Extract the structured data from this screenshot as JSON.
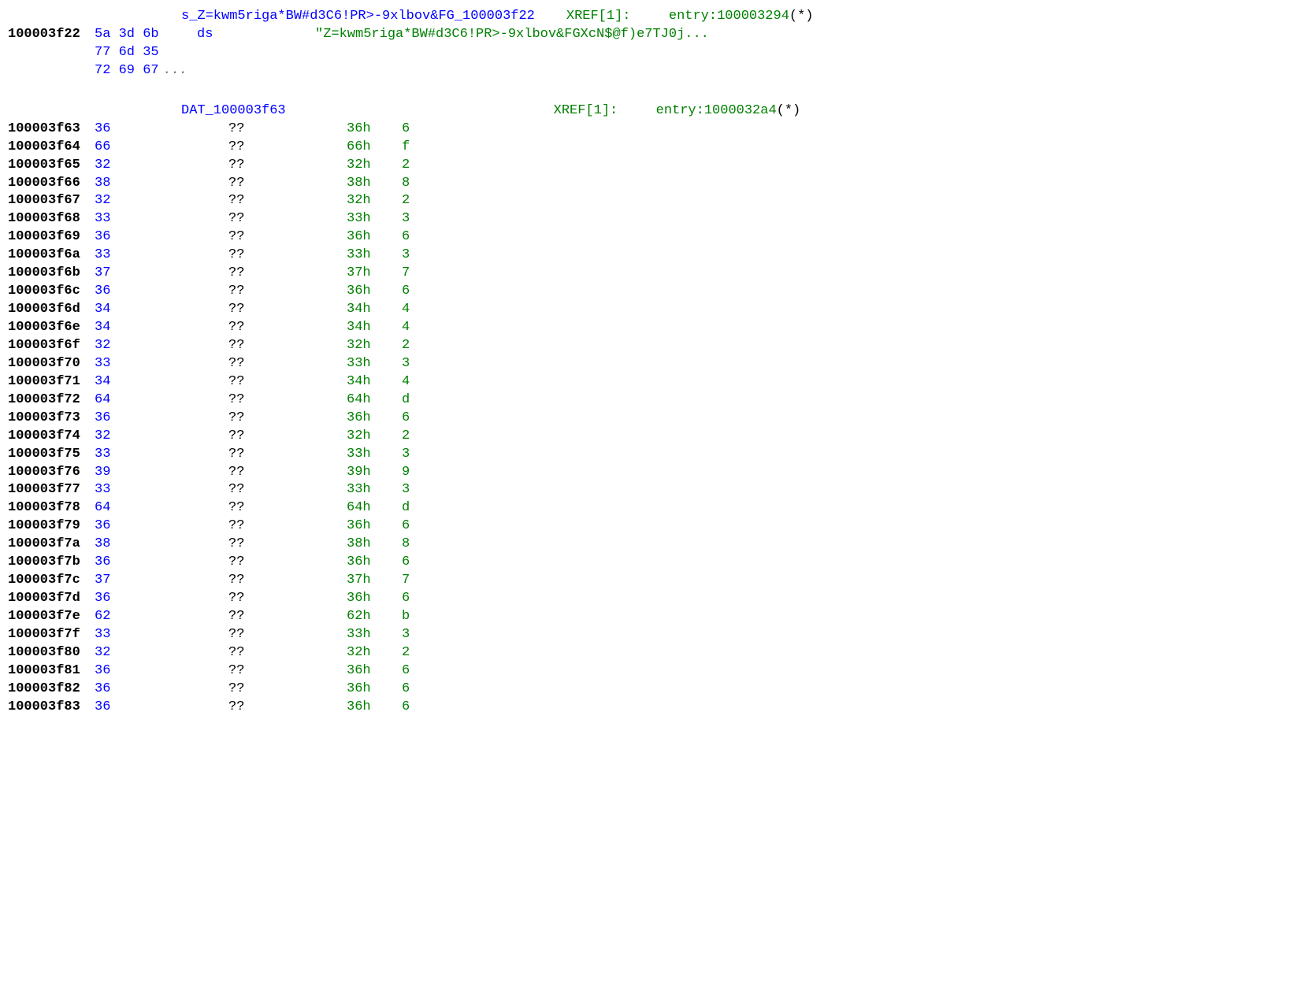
{
  "string_section": {
    "label_name": "s_Z=kwm5riga*BW#d3C6!PR>-9xlbov&FG_100003f22",
    "xref_lbl": "XREF[1]:",
    "xref_val": "entry:100003294",
    "xref_star": "(*)",
    "addr": "100003f22",
    "bytes_rows": [
      "5a 3d 6b",
      "77 6d 35",
      "72 69 67"
    ],
    "ellipsis": "...",
    "mnemonic": "ds",
    "string_value": "\"Z=kwm5riga*BW#d3C6!PR>-9xlbov&FGXcN$@f)e7TJ0j..."
  },
  "data_section": {
    "label_name": "DAT_100003f63",
    "xref_lbl": "XREF[1]:",
    "xref_val": "entry:1000032a4",
    "xref_star": "(*)",
    "qmark": "??",
    "rows": [
      {
        "addr": "100003f63",
        "byte": "36",
        "hex": "36h",
        "ch": "6"
      },
      {
        "addr": "100003f64",
        "byte": "66",
        "hex": "66h",
        "ch": "f"
      },
      {
        "addr": "100003f65",
        "byte": "32",
        "hex": "32h",
        "ch": "2"
      },
      {
        "addr": "100003f66",
        "byte": "38",
        "hex": "38h",
        "ch": "8"
      },
      {
        "addr": "100003f67",
        "byte": "32",
        "hex": "32h",
        "ch": "2"
      },
      {
        "addr": "100003f68",
        "byte": "33",
        "hex": "33h",
        "ch": "3"
      },
      {
        "addr": "100003f69",
        "byte": "36",
        "hex": "36h",
        "ch": "6"
      },
      {
        "addr": "100003f6a",
        "byte": "33",
        "hex": "33h",
        "ch": "3"
      },
      {
        "addr": "100003f6b",
        "byte": "37",
        "hex": "37h",
        "ch": "7"
      },
      {
        "addr": "100003f6c",
        "byte": "36",
        "hex": "36h",
        "ch": "6"
      },
      {
        "addr": "100003f6d",
        "byte": "34",
        "hex": "34h",
        "ch": "4"
      },
      {
        "addr": "100003f6e",
        "byte": "34",
        "hex": "34h",
        "ch": "4"
      },
      {
        "addr": "100003f6f",
        "byte": "32",
        "hex": "32h",
        "ch": "2"
      },
      {
        "addr": "100003f70",
        "byte": "33",
        "hex": "33h",
        "ch": "3"
      },
      {
        "addr": "100003f71",
        "byte": "34",
        "hex": "34h",
        "ch": "4"
      },
      {
        "addr": "100003f72",
        "byte": "64",
        "hex": "64h",
        "ch": "d"
      },
      {
        "addr": "100003f73",
        "byte": "36",
        "hex": "36h",
        "ch": "6"
      },
      {
        "addr": "100003f74",
        "byte": "32",
        "hex": "32h",
        "ch": "2"
      },
      {
        "addr": "100003f75",
        "byte": "33",
        "hex": "33h",
        "ch": "3"
      },
      {
        "addr": "100003f76",
        "byte": "39",
        "hex": "39h",
        "ch": "9"
      },
      {
        "addr": "100003f77",
        "byte": "33",
        "hex": "33h",
        "ch": "3"
      },
      {
        "addr": "100003f78",
        "byte": "64",
        "hex": "64h",
        "ch": "d"
      },
      {
        "addr": "100003f79",
        "byte": "36",
        "hex": "36h",
        "ch": "6"
      },
      {
        "addr": "100003f7a",
        "byte": "38",
        "hex": "38h",
        "ch": "8"
      },
      {
        "addr": "100003f7b",
        "byte": "36",
        "hex": "36h",
        "ch": "6"
      },
      {
        "addr": "100003f7c",
        "byte": "37",
        "hex": "37h",
        "ch": "7"
      },
      {
        "addr": "100003f7d",
        "byte": "36",
        "hex": "36h",
        "ch": "6"
      },
      {
        "addr": "100003f7e",
        "byte": "62",
        "hex": "62h",
        "ch": "b"
      },
      {
        "addr": "100003f7f",
        "byte": "33",
        "hex": "33h",
        "ch": "3"
      },
      {
        "addr": "100003f80",
        "byte": "32",
        "hex": "32h",
        "ch": "2"
      },
      {
        "addr": "100003f81",
        "byte": "36",
        "hex": "36h",
        "ch": "6"
      },
      {
        "addr": "100003f82",
        "byte": "36",
        "hex": "36h",
        "ch": "6"
      },
      {
        "addr": "100003f83",
        "byte": "36",
        "hex": "36h",
        "ch": "6"
      }
    ]
  }
}
